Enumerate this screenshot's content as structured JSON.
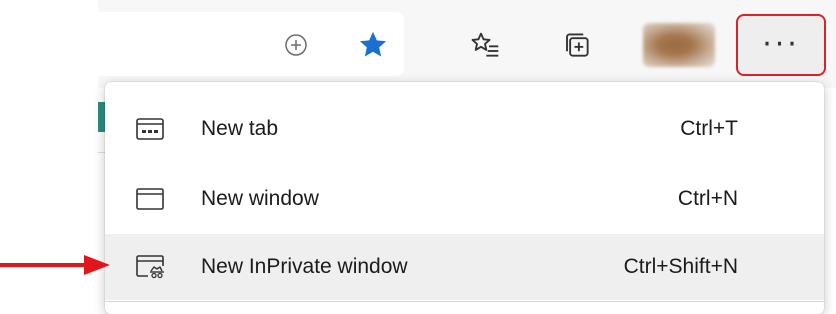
{
  "toolbar": {
    "icons": {
      "add_favorite": "circle-plus-icon",
      "favorite": "star-icon",
      "favorites": "favorites-list-icon",
      "collections": "collections-icon",
      "more": "ellipsis-icon"
    },
    "more_label": "···"
  },
  "menu": {
    "items": [
      {
        "label": "New tab",
        "shortcut": "Ctrl+T",
        "icon": "new-tab-icon"
      },
      {
        "label": "New window",
        "shortcut": "Ctrl+N",
        "icon": "new-window-icon"
      },
      {
        "label": "New InPrivate window",
        "shortcut": "Ctrl+Shift+N",
        "icon": "inprivate-window-icon"
      }
    ]
  },
  "colors": {
    "star": "#1a6fd1",
    "highlight_border": "#d9232b",
    "arrow": "#e0161b",
    "hover": "#efefef"
  }
}
